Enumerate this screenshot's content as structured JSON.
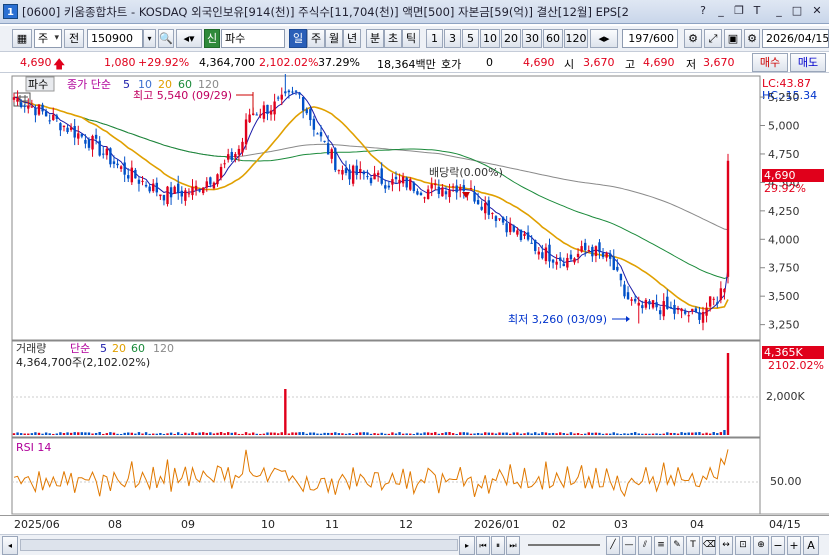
{
  "window": {
    "app_number": "1",
    "title": "[0600] 키움종합차트 - KOSDAQ 외국인보유[914(천)] 주식수[11,704(천)] 액면[500] 자본금[59(억)] 결산[12월] EPS[2",
    "buttons": [
      "?",
      "_",
      "❐",
      "T",
      "_",
      "□",
      "✕"
    ]
  },
  "toolbar": {
    "period_select": "주",
    "prev_label": "전",
    "stock_code": "150900",
    "badge_label": "신",
    "stock_name": "파수",
    "timeframes": [
      "일",
      "주",
      "월",
      "년",
      "분",
      "초",
      "틱"
    ],
    "selected_timeframe": "일",
    "intervals": [
      "1",
      "3",
      "5",
      "10",
      "20",
      "30",
      "60",
      "120"
    ],
    "page_count": "197/600",
    "date": "2026/04/15"
  },
  "quote": {
    "price": "4,690",
    "change": "1,080",
    "change_pct": "+29.92%",
    "volume": "4,364,700",
    "vol_ratio": "2,102.02%",
    "turnover": "37.29%",
    "amount": "18,364백만",
    "hoga_label": "호가",
    "hoga_value": "0",
    "close2": "4,690",
    "open_label": "시",
    "open": "3,670",
    "high_label": "고",
    "high": "4,690",
    "low_label": "저",
    "low": "3,670",
    "buy_label": "매수",
    "sell_label": "매도"
  },
  "price_panel": {
    "name_tag": "파수",
    "legend": [
      "종가 단순",
      "5",
      "10",
      "20",
      "60",
      "120"
    ],
    "lc_label": "LC:43.87",
    "hc_label": "HC:-15.34",
    "high_note": "최고 5,540 (09/29)",
    "low_note": "최저 3,260 (03/09)",
    "dividend_note": "배당락(0.00%)",
    "current_price_tag": "4,690",
    "current_pct_tag": "29.92%",
    "yticks": [
      "5,250",
      "5,000",
      "4,750",
      "4,500",
      "4,250",
      "4,000",
      "3,750",
      "3,500",
      "3,250"
    ]
  },
  "volume_panel": {
    "legend_label": "거래량",
    "legend_ma": "단순",
    "ma_periods": [
      "5",
      "20",
      "60",
      "120"
    ],
    "info": "4,364,700주(2,102.02%)",
    "tag_value": "4,365K",
    "tag_pct": "2102.02%",
    "ytick": "2,000K"
  },
  "rsi_panel": {
    "legend": "RSI 14",
    "ytick": "50.00"
  },
  "xaxis": {
    "labels": [
      "2025/06",
      "08",
      "09",
      "10",
      "11",
      "12",
      "2026/01",
      "02",
      "03",
      "04",
      "04/15"
    ]
  },
  "colors": {
    "up": "#e0001b",
    "down": "#0050c8",
    "ma5": "#1a1aa8",
    "ma20": "#e0a000",
    "ma60": "#1a8a3a",
    "ma120": "#8a8a8a",
    "rsi": "#e07800"
  },
  "chart_data": {
    "type": "candlestick",
    "title": "파수 150900 일봉",
    "y_range": [
      3150,
      5400
    ],
    "first_close": 5250,
    "x_labels": [
      "2025/06",
      "08",
      "09",
      "10",
      "11",
      "12",
      "2026/01",
      "02",
      "03",
      "04"
    ],
    "high": {
      "value": 5540,
      "date": "09/29"
    },
    "low": {
      "value": 3260,
      "date": "03/09"
    },
    "last": {
      "close": 4690,
      "change_pct": 29.92
    }
  }
}
